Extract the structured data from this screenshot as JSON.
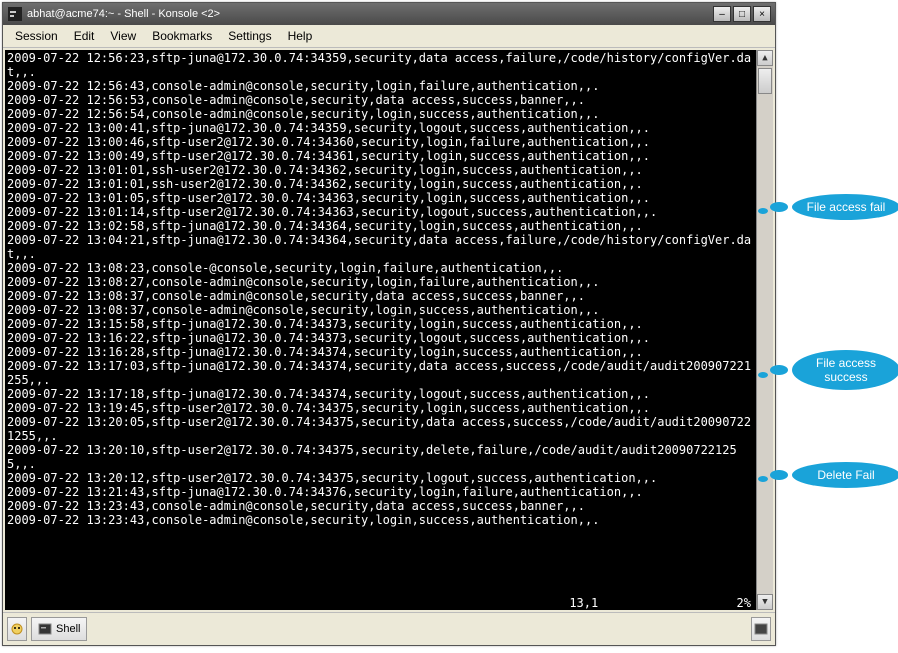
{
  "window": {
    "title": "abhat@acme74:~ - Shell - Konsole <2>"
  },
  "menu": {
    "session": "Session",
    "edit": "Edit",
    "view": "View",
    "bookmarks": "Bookmarks",
    "settings": "Settings",
    "help": "Help"
  },
  "terminal": {
    "lines": [
      "2009-07-22 12:56:23,sftp-juna@172.30.0.74:34359,security,data access,failure,/code/history/configVer.dat,,.",
      "2009-07-22 12:56:43,console-admin@console,security,login,failure,authentication,,.",
      "2009-07-22 12:56:53,console-admin@console,security,data access,success,banner,,.",
      "2009-07-22 12:56:54,console-admin@console,security,login,success,authentication,,.",
      "2009-07-22 13:00:41,sftp-juna@172.30.0.74:34359,security,logout,success,authentication,,.",
      "2009-07-22 13:00:46,sftp-user2@172.30.0.74:34360,security,login,failure,authentication,,.",
      "2009-07-22 13:00:49,sftp-user2@172.30.0.74:34361,security,login,success,authentication,,.",
      "2009-07-22 13:01:01,ssh-user2@172.30.0.74:34362,security,login,success,authentication,,.",
      "2009-07-22 13:01:01,ssh-user2@172.30.0.74:34362,security,login,success,authentication,,.",
      "2009-07-22 13:01:05,sftp-user2@172.30.0.74:34363,security,login,success,authentication,,.",
      "2009-07-22 13:01:14,sftp-user2@172.30.0.74:34363,security,logout,success,authentication,,.",
      "2009-07-22 13:02:58,sftp-juna@172.30.0.74:34364,security,login,success,authentication,,.",
      "2009-07-22 13:04:21,sftp-juna@172.30.0.74:34364,security,data access,failure,/code/history/configVer.dat,,.",
      "2009-07-22 13:08:23,console-@console,security,login,failure,authentication,,.",
      "2009-07-22 13:08:27,console-admin@console,security,login,failure,authentication,,.",
      "2009-07-22 13:08:37,console-admin@console,security,data access,success,banner,,.",
      "2009-07-22 13:08:37,console-admin@console,security,login,success,authentication,,.",
      "2009-07-22 13:15:58,sftp-juna@172.30.0.74:34373,security,login,success,authentication,,.",
      "2009-07-22 13:16:22,sftp-juna@172.30.0.74:34373,security,logout,success,authentication,,.",
      "2009-07-22 13:16:28,sftp-juna@172.30.0.74:34374,security,login,success,authentication,,.",
      "2009-07-22 13:17:03,sftp-juna@172.30.0.74:34374,security,data access,success,/code/audit/audit200907221255,,.",
      "2009-07-22 13:17:18,sftp-juna@172.30.0.74:34374,security,logout,success,authentication,,.",
      "2009-07-22 13:19:45,sftp-user2@172.30.0.74:34375,security,login,success,authentication,,.",
      "2009-07-22 13:20:05,sftp-user2@172.30.0.74:34375,security,data access,success,/code/audit/audit200907221255,,.",
      "2009-07-22 13:20:10,sftp-user2@172.30.0.74:34375,security,delete,failure,/code/audit/audit200907221255,,.",
      "2009-07-22 13:20:12,sftp-user2@172.30.0.74:34375,security,logout,success,authentication,,.",
      "2009-07-22 13:21:43,sftp-juna@172.30.0.74:34376,security,login,failure,authentication,,.",
      "2009-07-22 13:23:43,console-admin@console,security,data access,success,banner,,.",
      "2009-07-22 13:23:43,console-admin@console,security,login,success,authentication,,."
    ],
    "status_pos": "13,1",
    "status_pct": "2%"
  },
  "bottombar": {
    "tab": "Shell"
  },
  "callouts": {
    "c1": "File access fail",
    "c2_line1": "File access",
    "c2_line2": "success",
    "c3": "Delete Fail"
  }
}
